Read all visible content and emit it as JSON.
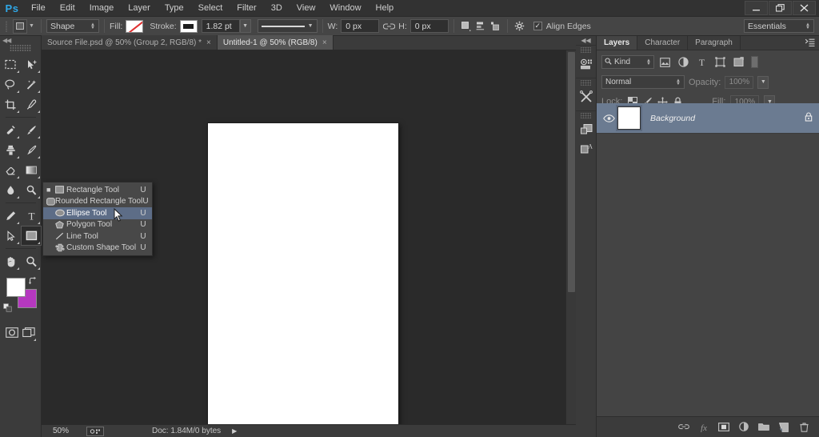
{
  "app": {
    "logo": "Ps",
    "workspace": "Essentials"
  },
  "menubar": {
    "items": [
      {
        "label": "File"
      },
      {
        "label": "Edit"
      },
      {
        "label": "Image"
      },
      {
        "label": "Layer"
      },
      {
        "label": "Type"
      },
      {
        "label": "Select"
      },
      {
        "label": "Filter"
      },
      {
        "label": "3D"
      },
      {
        "label": "View"
      },
      {
        "label": "Window"
      },
      {
        "label": "Help"
      }
    ]
  },
  "window_controls": {
    "minimize": "minimize-icon",
    "restore": "restore-icon",
    "close": "close-icon"
  },
  "options_bar": {
    "tool_preset_icon": "shape-tool-preset-icon",
    "mode_value": "Shape",
    "fill_label": "Fill:",
    "fill_swatch": "no-fill-swatch",
    "stroke_label": "Stroke:",
    "stroke_swatch": "black-stroke-swatch",
    "stroke_width": "1.82 pt",
    "stroke_style_icon": "solid-line-icon",
    "width_label": "W:",
    "width_value": "0 px",
    "link_icon": "link-dimensions-icon",
    "height_label": "H:",
    "height_value": "0 px",
    "path_operations_icon": "path-operations-icon",
    "path_alignment_icon": "path-alignment-icon",
    "path_arrangement_icon": "path-arrangement-icon",
    "settings_icon": "gear-icon",
    "align_edges_label": "Align Edges",
    "align_edges_checked": "✓"
  },
  "toolbar": {
    "tools": [
      {
        "name": "marquee-tool",
        "icon": "marquee",
        "active": false
      },
      {
        "name": "move-tool",
        "icon": "move",
        "active": false
      },
      {
        "name": "lasso-tool",
        "icon": "lasso",
        "active": false
      },
      {
        "name": "magic-wand-tool",
        "icon": "wand",
        "active": false
      },
      {
        "name": "crop-tool",
        "icon": "crop",
        "active": false
      },
      {
        "name": "eyedropper-tool",
        "icon": "eyedropper",
        "active": false
      },
      {
        "name": "healing-brush-tool",
        "icon": "healing",
        "active": false
      },
      {
        "name": "brush-tool",
        "icon": "brush",
        "active": false
      },
      {
        "name": "clone-stamp-tool",
        "icon": "stamp",
        "active": false
      },
      {
        "name": "history-brush-tool",
        "icon": "history-brush",
        "active": false
      },
      {
        "name": "eraser-tool",
        "icon": "eraser",
        "active": false
      },
      {
        "name": "gradient-tool",
        "icon": "gradient",
        "active": false
      },
      {
        "name": "blur-tool",
        "icon": "blur",
        "active": false
      },
      {
        "name": "dodge-tool",
        "icon": "dodge",
        "active": false
      },
      {
        "name": "pen-tool",
        "icon": "pen",
        "active": false
      },
      {
        "name": "type-tool",
        "icon": "type",
        "active": false
      },
      {
        "name": "path-selection-tool",
        "icon": "path-select",
        "active": false
      },
      {
        "name": "rectangle-tool",
        "icon": "shape",
        "active": true
      },
      {
        "name": "hand-tool",
        "icon": "hand",
        "active": false
      },
      {
        "name": "zoom-tool",
        "icon": "zoom",
        "active": false
      }
    ],
    "foreground_color": "#ffffff",
    "background_color": "#b538bf",
    "quick_mask_icon": "quick-mask-icon",
    "screen_mode_icon": "screen-mode-icon",
    "swap_colors_icon": "swap-colors-icon",
    "default_colors_icon": "default-colors-icon"
  },
  "flyout_menu": {
    "items": [
      {
        "label": "Rectangle Tool",
        "shortcut": "U",
        "icon": "rectangle-icon",
        "selected": false,
        "current": true
      },
      {
        "label": "Rounded Rectangle Tool",
        "shortcut": "U",
        "icon": "rounded-rectangle-icon",
        "selected": false,
        "current": false
      },
      {
        "label": "Ellipse Tool",
        "shortcut": "U",
        "icon": "ellipse-icon",
        "selected": true,
        "current": false
      },
      {
        "label": "Polygon Tool",
        "shortcut": "U",
        "icon": "polygon-icon",
        "selected": false,
        "current": false
      },
      {
        "label": "Line Tool",
        "shortcut": "U",
        "icon": "line-icon",
        "selected": false,
        "current": false
      },
      {
        "label": "Custom Shape Tool",
        "shortcut": "U",
        "icon": "custom-shape-icon",
        "selected": false,
        "current": false
      }
    ],
    "highlight_color": "#5d6d87"
  },
  "document_tabs": [
    {
      "label": "Source File.psd @ 50% (Group 2, RGB/8) *",
      "active": false,
      "close": "×"
    },
    {
      "label": "Untitled-1 @ 50% (RGB/8)",
      "active": true,
      "close": "×"
    }
  ],
  "status_bar": {
    "zoom": "50%",
    "doc_icon": "document-size-icon",
    "doc_info": "Doc: 1.84M/0 bytes",
    "play_icon": "expand-arrow-icon"
  },
  "icon_dock": {
    "collapse_icon": "collapse-panels-icon",
    "buttons": [
      {
        "name": "color-swatches-panel-icon"
      },
      {
        "name": "adjustments-panel-icon"
      },
      {
        "name": "history-panel-icon"
      },
      {
        "name": "character-styles-panel-icon"
      }
    ]
  },
  "layers_panel": {
    "tabs": [
      {
        "label": "Layers",
        "active": true
      },
      {
        "label": "Character",
        "active": false
      },
      {
        "label": "Paragraph",
        "active": false
      }
    ],
    "menu_icon": "panel-menu-icon",
    "filter": {
      "search_icon": "search-icon",
      "kind_value": "Kind",
      "buttons": [
        {
          "name": "filter-pixel-icon"
        },
        {
          "name": "filter-adjustment-icon"
        },
        {
          "name": "filter-type-icon"
        },
        {
          "name": "filter-shape-icon"
        },
        {
          "name": "filter-smart-object-icon"
        }
      ],
      "toggle": "filter-enable-toggle"
    },
    "blend_mode": "Normal",
    "opacity_label": "Opacity:",
    "opacity_value": "100%",
    "lock_label": "Lock:",
    "lock_buttons": [
      {
        "name": "lock-transparent-pixels-icon"
      },
      {
        "name": "lock-image-pixels-icon"
      },
      {
        "name": "lock-position-icon"
      },
      {
        "name": "lock-all-icon"
      }
    ],
    "fill_label": "Fill:",
    "fill_value": "100%",
    "layers": [
      {
        "name": "Background",
        "visible": true,
        "locked": true,
        "selected": true
      }
    ],
    "selected_row_color": "#6b7b91",
    "footer_buttons": [
      {
        "name": "link-layers-icon"
      },
      {
        "name": "layer-styles-fx-icon"
      },
      {
        "name": "add-layer-mask-icon"
      },
      {
        "name": "new-adjustment-layer-icon"
      },
      {
        "name": "new-group-icon"
      },
      {
        "name": "new-layer-icon"
      },
      {
        "name": "delete-layer-icon"
      }
    ]
  }
}
